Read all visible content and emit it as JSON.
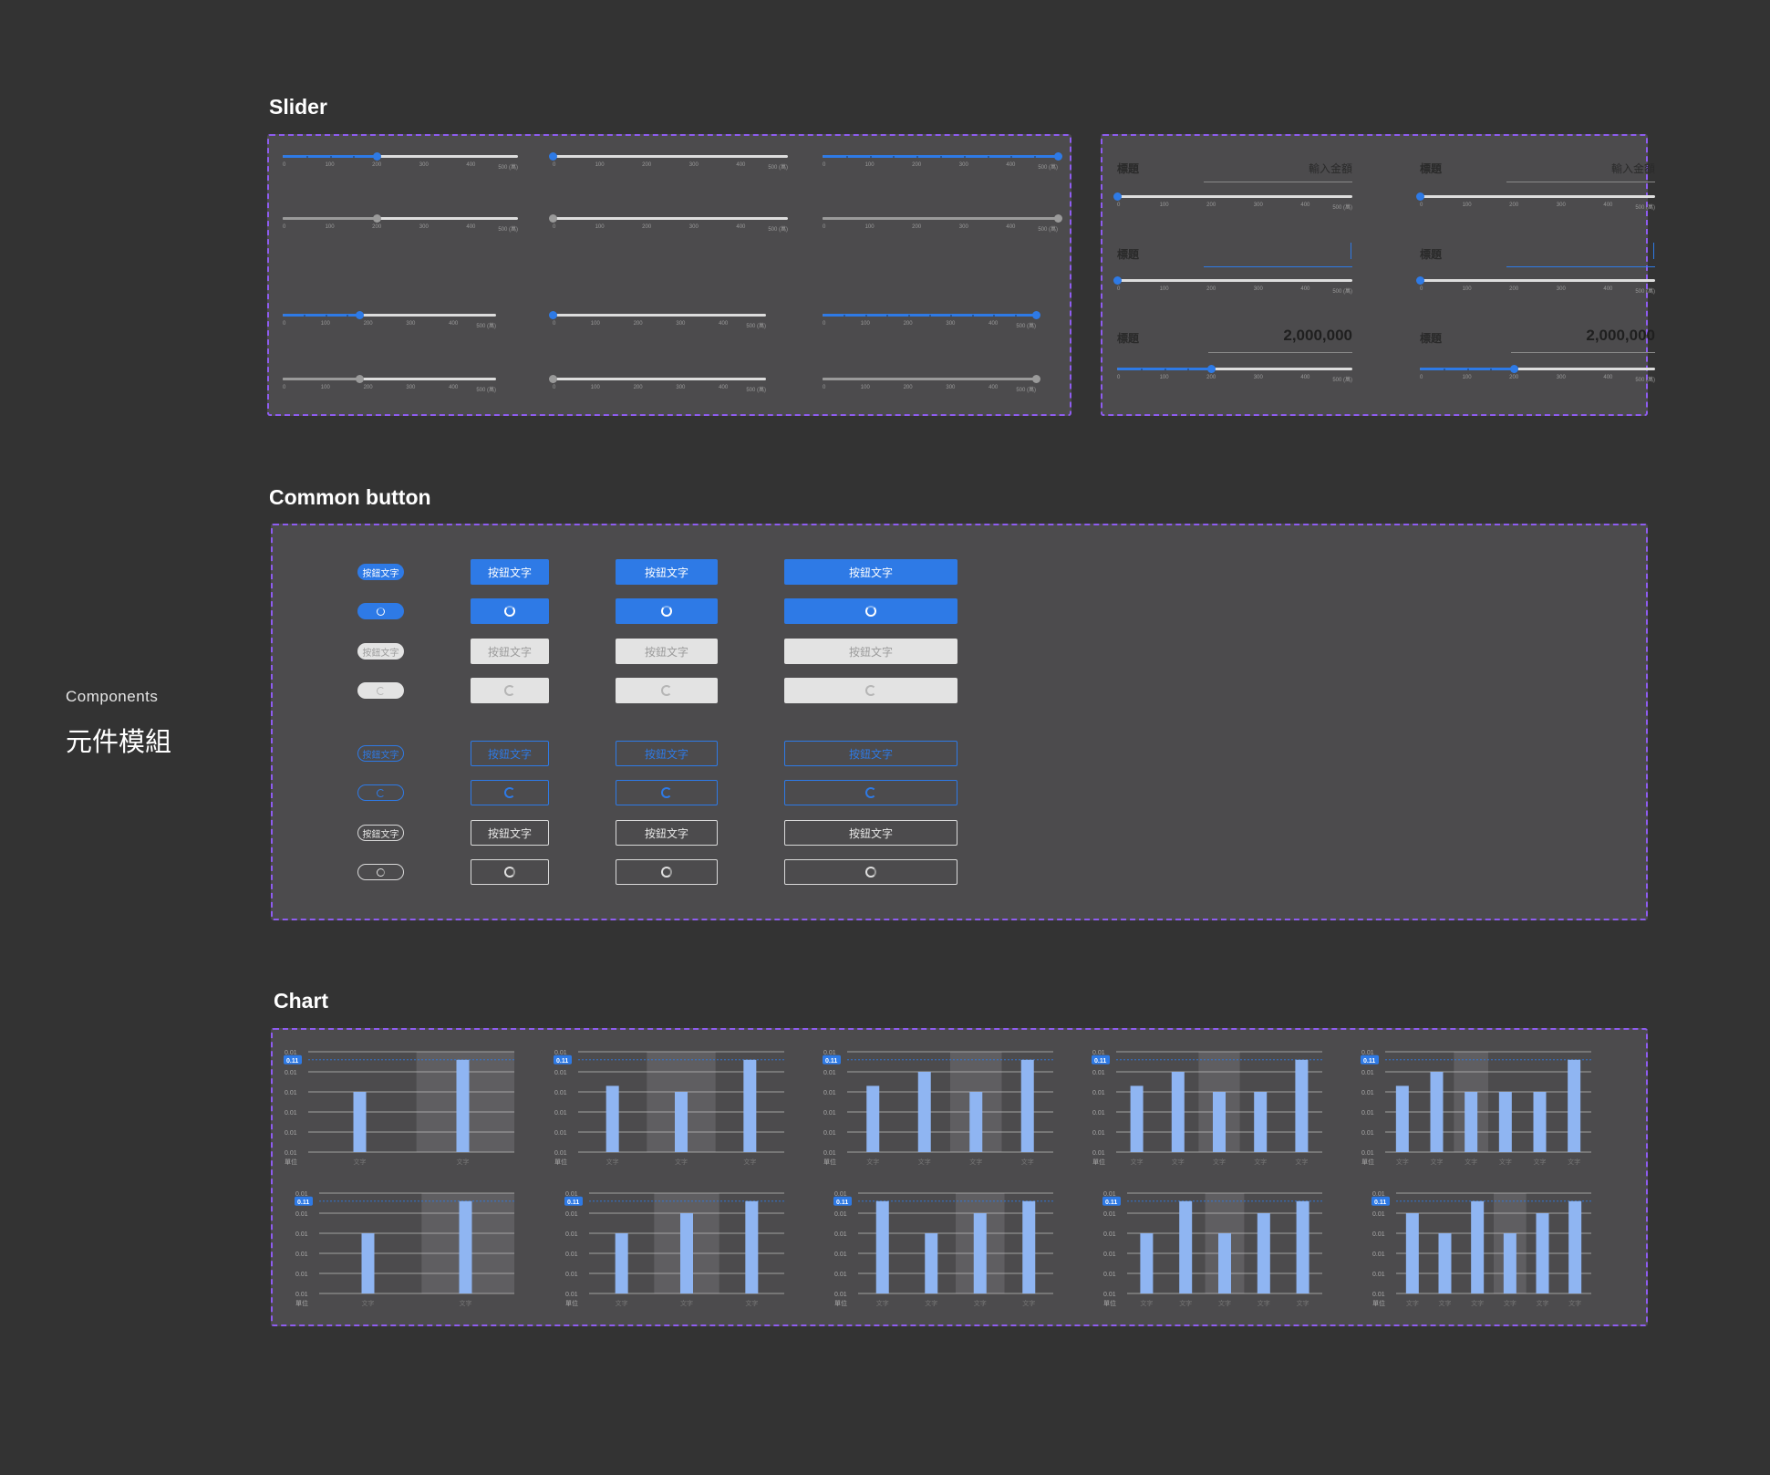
{
  "sections": {
    "slider": "Slider",
    "common_button": "Common button",
    "chart": "Chart"
  },
  "side": {
    "en": "Components",
    "zh": "元件模組"
  },
  "slider_ticks": [
    "0",
    "100",
    "200",
    "300",
    "400",
    "500 (萬)"
  ],
  "slider_form": {
    "label": "標題",
    "placeholder": "輸入金額",
    "amount": "2,000,000"
  },
  "sliders": [
    {
      "value": 200,
      "style": "blue"
    },
    {
      "value": 0,
      "style": "blue"
    },
    {
      "value": 500,
      "style": "blue"
    },
    {
      "value": 200,
      "style": "gray"
    },
    {
      "value": 0,
      "style": "gray"
    },
    {
      "value": 500,
      "style": "gray"
    },
    {
      "value": 180,
      "style": "blue"
    },
    {
      "value": 0,
      "style": "blue"
    },
    {
      "value": 500,
      "style": "blue"
    },
    {
      "value": 180,
      "style": "gray"
    },
    {
      "value": 0,
      "style": "gray"
    },
    {
      "value": 500,
      "style": "gray"
    }
  ],
  "form_sliders": [
    {
      "value": 0,
      "state": "placeholder"
    },
    {
      "value": 0,
      "state": "placeholder"
    },
    {
      "value": 0,
      "state": "focus"
    },
    {
      "value": 0,
      "state": "focus"
    },
    {
      "value": 200,
      "state": "filled"
    },
    {
      "value": 200,
      "state": "filled"
    }
  ],
  "button_label": "按鈕文字",
  "buttons_rows": [
    {
      "variant": "primary",
      "loading": false
    },
    {
      "variant": "primary",
      "loading": true
    },
    {
      "variant": "disabled",
      "loading": false
    },
    {
      "variant": "disabled",
      "loading": true
    },
    {
      "variant": "outline-blue",
      "loading": false
    },
    {
      "variant": "outline-blue",
      "loading": true
    },
    {
      "variant": "outline-dark",
      "loading": false
    },
    {
      "variant": "outline-dark",
      "loading": true
    }
  ],
  "chart_data": {
    "type": "bar",
    "y_tick_label": "0.01",
    "highlight_label": "0.11",
    "x_label": "文字",
    "unit_label": "單位",
    "colors": {
      "bar": "#8fb5f2",
      "highlight_badge": "#2e7ae6",
      "band": "#5f5e61"
    },
    "charts": [
      {
        "values": [
          0.6,
          0.92
        ],
        "highlight_index": 1
      },
      {
        "values": [
          0.66,
          0.6,
          0.92
        ],
        "highlight_index": 1
      },
      {
        "values": [
          0.66,
          0.8,
          0.6,
          0.92
        ],
        "highlight_index": 2
      },
      {
        "values": [
          0.66,
          0.8,
          0.6,
          0.6,
          0.92
        ],
        "highlight_index": 2
      },
      {
        "values": [
          0.66,
          0.8,
          0.6,
          0.6,
          0.6,
          0.92
        ],
        "highlight_index": 2
      },
      {
        "values": [
          0.6,
          0.92
        ],
        "highlight_index": 1
      },
      {
        "values": [
          0.6,
          0.8,
          0.92
        ],
        "highlight_index": 1
      },
      {
        "values": [
          0.92,
          0.6,
          0.8,
          0.92
        ],
        "highlight_index": 2
      },
      {
        "values": [
          0.6,
          0.92,
          0.6,
          0.8,
          0.92
        ],
        "highlight_index": 2
      },
      {
        "values": [
          0.8,
          0.6,
          0.92,
          0.6,
          0.8,
          0.92
        ],
        "highlight_index": 3
      }
    ]
  }
}
